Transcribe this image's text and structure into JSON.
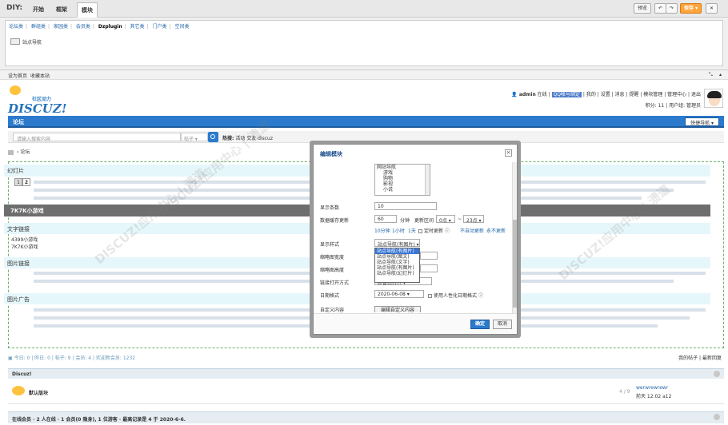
{
  "diy": {
    "title": "DIY:",
    "tabs": [
      "开始",
      "框架",
      "模块"
    ],
    "subtabs": [
      "论坛类",
      "群组类",
      "家园类",
      "会员类",
      "Dzplugin",
      "其它类",
      "门户类",
      "空间类"
    ],
    "module_item": "站点导航",
    "preview_label": "预览",
    "save_label": "保存"
  },
  "toplinks": {
    "set_home": "设为首页",
    "bookmark": "收藏本站"
  },
  "logo": {
    "slogan": "社区动力",
    "word": "DISCUZ!"
  },
  "user": {
    "name": "admin",
    "status": "在线",
    "qq": "QQ帐号绑定",
    "links": [
      "我的",
      "设置",
      "消息",
      "提醒",
      "模块管理",
      "管理中心",
      "退出"
    ],
    "points": "积分: 11",
    "group": "用户组: 管理员"
  },
  "nav": {
    "item": "论坛",
    "quicknav": "快捷导航"
  },
  "search": {
    "placeholder": "请输入搜索内容",
    "type": "帖子",
    "hot_label": "热搜:",
    "hot_words": "活动  交友  discuz"
  },
  "breadcrumb": "论坛",
  "blocks": {
    "slides": "幻灯片",
    "slide_caption": "7K7K小游戏",
    "pages": [
      "1",
      "2"
    ],
    "text_links": "文字链接",
    "text_items": [
      "4399小游戏",
      "7K7K小游戏"
    ],
    "image_links": "图片链接",
    "image_ads": "图片广告"
  },
  "modal": {
    "title": "编辑模块",
    "list_items": [
      "网站导航",
      "游戏",
      "购物",
      "影视",
      "小说"
    ],
    "display_count_label": "显示条数",
    "display_count": "10",
    "cache_label": "数据缓存更新",
    "cache_value": "60",
    "cache_unit": "分钟",
    "interval_label": "更新区间",
    "hour_from": "0点",
    "hour_sep": "~",
    "hour_to": "23点",
    "quick_times": [
      "10分钟",
      "1小时",
      "1天"
    ],
    "timed_update": "定时更新",
    "no_auto": "不自动更新",
    "never_update": "永不更新",
    "style_label": "显示样式",
    "style_value": "站点导航(有图片)",
    "style_options": [
      "站点导航(有图片)",
      "站点导航(图文)",
      "站点导航(文字)",
      "站点导航(有图片)",
      "站点导航(幻灯片)"
    ],
    "thumb_w_label": "缩略图宽度",
    "thumb_h_label": "缩略图高度",
    "link_open_label": "链接打开方式",
    "link_open_value": "新窗口打开",
    "date_label": "日期格式",
    "date_value": "2020-06-08",
    "humanize": "使用人性化日期格式",
    "custom_label": "自定义内容",
    "custom_btn": "编辑自定义内容",
    "ok": "确定",
    "cancel": "取消"
  },
  "stats": {
    "text": "今日: 0 | 昨日: 0 | 帖子: 9 | 会员: 4 | 欢迎新会员: 1232",
    "my_posts": "我的帖子",
    "latest": "最新回复"
  },
  "forum": {
    "category": "Discuz!",
    "name": "默认版块",
    "count": "4 / 9",
    "last_title": "werwrewrewr",
    "last_time": "前天 12:02 a12"
  },
  "online": "在线会员 · 2 人在线 · 1 会员(0 隐身), 1 位游客 · 最高记录是 4 于 2020-6-6.",
  "watermark": "DISCUZ!应用中心 | 溃道"
}
